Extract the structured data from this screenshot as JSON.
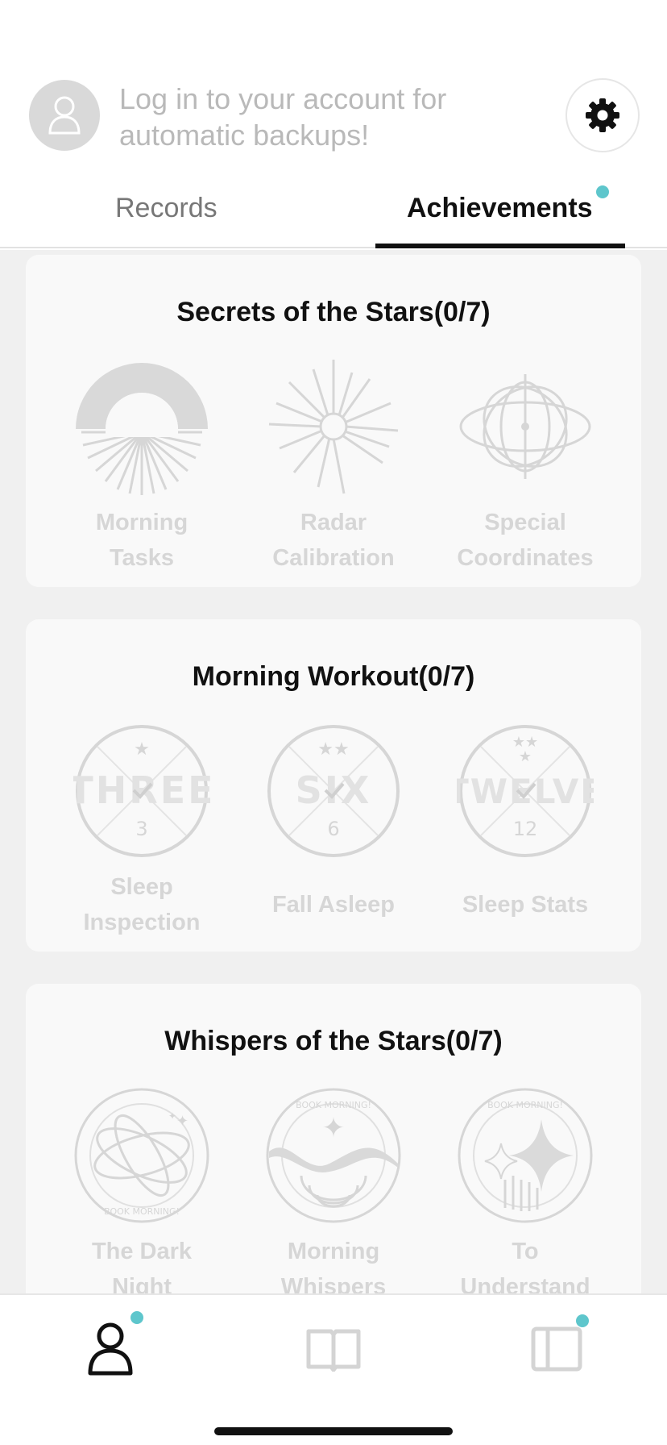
{
  "header": {
    "login_prompt": "Log in to your account for automatic backups!"
  },
  "tabs": [
    {
      "label": "Records",
      "active": false
    },
    {
      "label": "Achievements",
      "active": true,
      "has_notification": true
    }
  ],
  "sections": [
    {
      "title": "Secrets of the Stars(0/7)",
      "badges": [
        {
          "label": "Morning Tasks",
          "icon": "sunrise-badge-icon",
          "locked": true
        },
        {
          "label": "Radar Calibration",
          "icon": "starburst-badge-icon",
          "locked": true
        },
        {
          "label": "Special Coordinates",
          "icon": "orbit-badge-icon",
          "locked": true
        }
      ]
    },
    {
      "title": "Morning Workout(0/7)",
      "badges": [
        {
          "label": "Sleep Inspection",
          "icon": "three-stamp-icon",
          "locked": true,
          "stamp_word": "THREE",
          "stamp_number": "3"
        },
        {
          "label": "Fall Asleep",
          "icon": "six-stamp-icon",
          "locked": true,
          "stamp_word": "SIX",
          "stamp_number": "6"
        },
        {
          "label": "Sleep Stats",
          "icon": "twelve-stamp-icon",
          "locked": true,
          "stamp_word": "TWELVE",
          "stamp_number": "12"
        }
      ]
    },
    {
      "title": "Whispers of the Stars(0/7)",
      "badges": [
        {
          "label": "The Dark Night",
          "icon": "dark-night-badge-icon",
          "locked": true,
          "ring_text": "BOOK MORNING!"
        },
        {
          "label": "Morning Whispers",
          "icon": "waves-badge-icon",
          "locked": true,
          "ring_text": "BOOK MORNING!"
        },
        {
          "label": "To Understand the Stars",
          "icon": "sparkle-badge-icon",
          "locked": true,
          "ring_text": "BOOK MORNING!"
        }
      ]
    }
  ],
  "bottom_nav": [
    {
      "icon": "profile-icon",
      "active": true,
      "has_notification": true
    },
    {
      "icon": "book-icon",
      "active": false,
      "has_notification": false
    },
    {
      "icon": "panel-icon",
      "active": false,
      "has_notification": true
    }
  ],
  "colors": {
    "accent_dot": "#5ec6cc",
    "locked_badge": "#d6d6d6",
    "card_background": "#f9f9f9",
    "page_background": "#f0f0f0"
  }
}
